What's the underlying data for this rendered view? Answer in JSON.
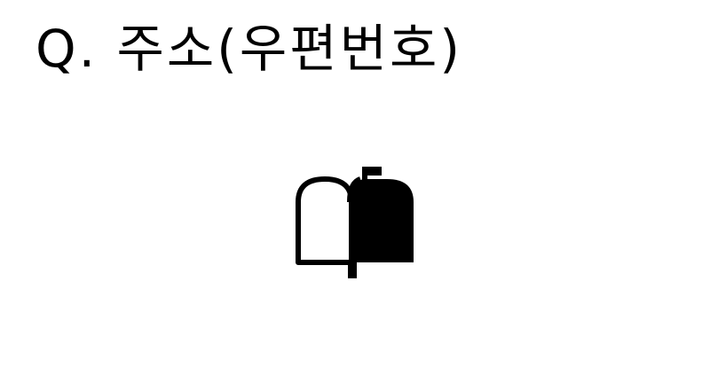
{
  "question": {
    "text": "Q. 주소(우편번호)"
  },
  "icon": {
    "name": "mailbox-icon",
    "fill_color": "#000000",
    "background_color": "#ffffff"
  }
}
